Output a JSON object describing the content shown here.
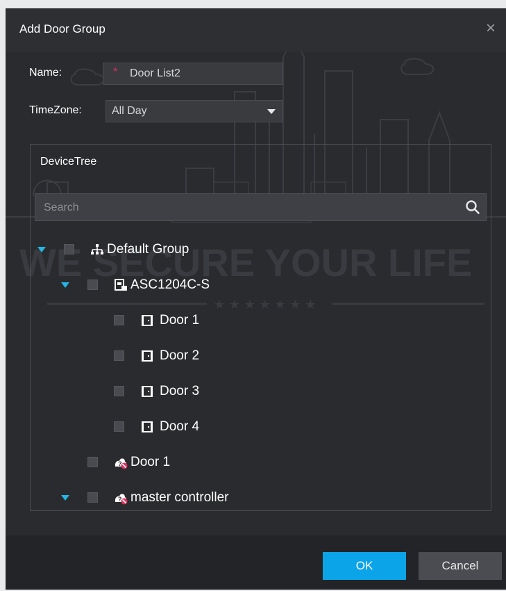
{
  "dialog": {
    "title": "Add Door Group",
    "close_symbol": "×"
  },
  "form": {
    "name_label": "Name:",
    "required_mark": "*",
    "name_value": "Door List2",
    "timezone_label": "TimeZone:",
    "timezone_value": "All Day"
  },
  "device_tree": {
    "title": "DeviceTree",
    "search_placeholder": "Search",
    "nodes": [
      {
        "label": "Default Group",
        "icon": "org-tree-icon",
        "expanded": true
      },
      {
        "label": "ASC1204C-S",
        "icon": "access-controller-icon",
        "expanded": true
      },
      {
        "label": "Door 1",
        "icon": "door-icon"
      },
      {
        "label": "Door 2",
        "icon": "door-icon"
      },
      {
        "label": "Door 3",
        "icon": "door-icon"
      },
      {
        "label": "Door 4",
        "icon": "door-icon"
      },
      {
        "label": "Door 1",
        "icon": "offline-device-icon"
      },
      {
        "label": "master controller",
        "icon": "offline-device-icon",
        "expanded": true
      }
    ]
  },
  "watermark": {
    "text": "WE SECURE YOUR LIFE"
  },
  "footer": {
    "ok_label": "OK",
    "cancel_label": "Cancel"
  },
  "colors": {
    "accent": "#0ca4e8",
    "expand_arrow": "#23b6e6",
    "required": "#e0315e",
    "dialog_bg": "#2a2b2e"
  }
}
